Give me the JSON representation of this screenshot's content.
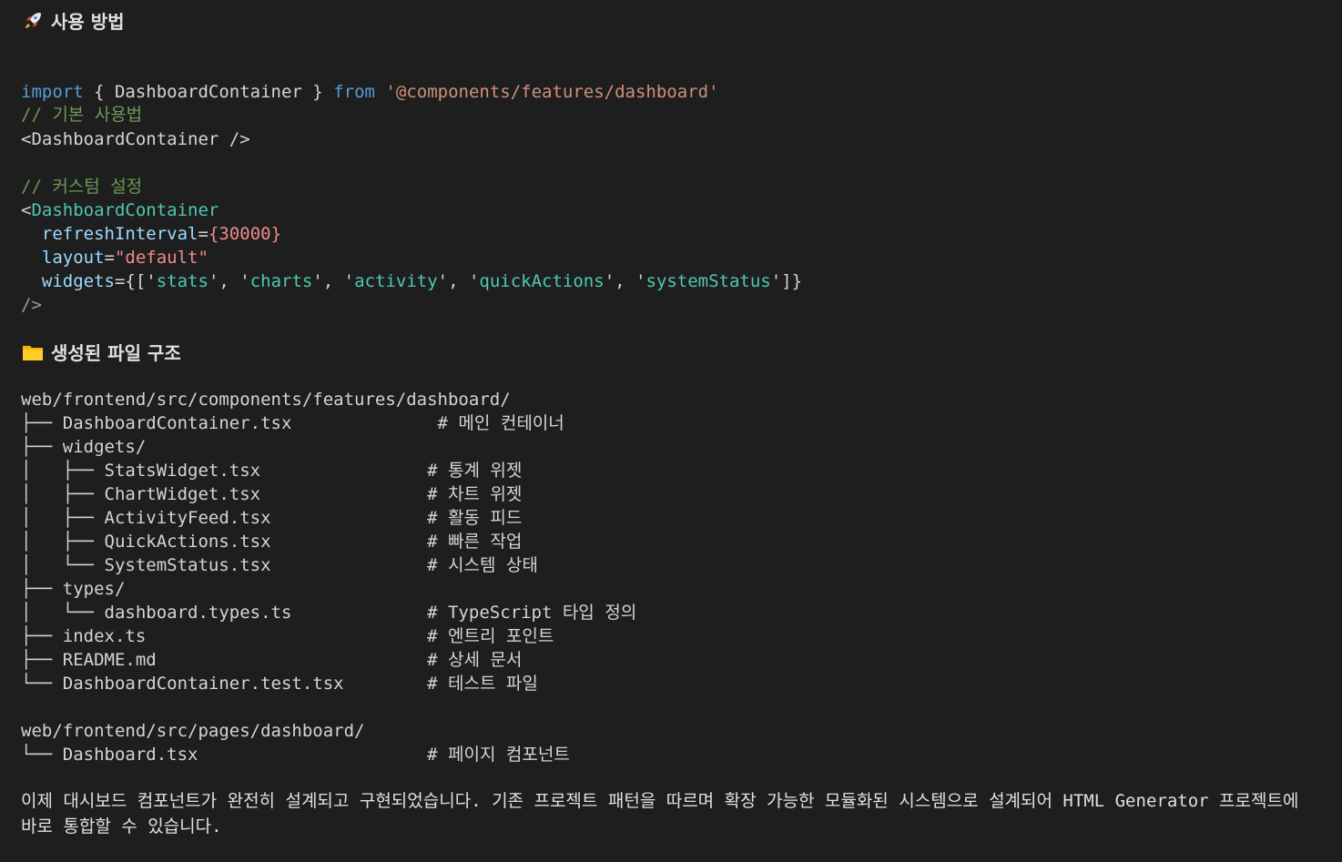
{
  "usage": {
    "heading": "사용 방법",
    "icon": "rocket-icon",
    "import_kw": "import",
    "import_names": "{ DashboardContainer }",
    "from_kw": "from",
    "import_path": "'@components/features/dashboard'",
    "comment_basic": "// 기본 사용법",
    "basic_tag": "<DashboardContainer />",
    "comment_custom": "// 커스텀 설정",
    "tag_open_lt": "<",
    "tag_name": "DashboardContainer",
    "prop1_name": "refreshInterval",
    "prop1_eq": "=",
    "prop1_value": "{30000}",
    "prop2_name": "layout",
    "prop2_eq": "=",
    "prop2_value": "\"default\"",
    "prop3_name": "widgets",
    "prop3_eq": "=",
    "prop3_open": "{['",
    "w1": "stats",
    "sep1": "', '",
    "w2": "charts",
    "sep2": "', '",
    "w3": "activity",
    "sep3": "', '",
    "w4": "quickActions",
    "sep4": "', '",
    "w5": "systemStatus",
    "prop3_close": "']}",
    "self_close": "/>"
  },
  "structure": {
    "heading": "생성된 파일 구조",
    "icon": "folder-icon",
    "lines": [
      "web/frontend/src/components/features/dashboard/",
      "├── DashboardContainer.tsx              # 메인 컨테이너",
      "├── widgets/",
      "│   ├── StatsWidget.tsx                # 통계 위젯",
      "│   ├── ChartWidget.tsx                # 차트 위젯",
      "│   ├── ActivityFeed.tsx               # 활동 피드",
      "│   ├── QuickActions.tsx               # 빠른 작업",
      "│   └── SystemStatus.tsx               # 시스템 상태",
      "├── types/",
      "│   └── dashboard.types.ts             # TypeScript 타입 정의",
      "├── index.ts                           # 엔트리 포인트",
      "├── README.md                          # 상세 문서",
      "└── DashboardContainer.test.tsx        # 테스트 파일",
      "",
      "web/frontend/src/pages/dashboard/",
      "└── Dashboard.tsx                      # 페이지 컴포넌트"
    ]
  },
  "summary": {
    "text": "이제 대시보드 컴포넌트가 완전히 설계되고 구현되었습니다. 기존 프로젝트 패턴을 따르며 확장 가능한 모듈화된 시스템으로 설계되어 HTML Generator 프로젝트에 바로 통합할 수 있습니다."
  },
  "colors": {
    "background": "#1e1e1e",
    "keyword": "#569cd6",
    "string": "#ce9178",
    "comment": "#6a9955",
    "tag": "#4ec9b0",
    "attribute": "#9cdcfe"
  }
}
